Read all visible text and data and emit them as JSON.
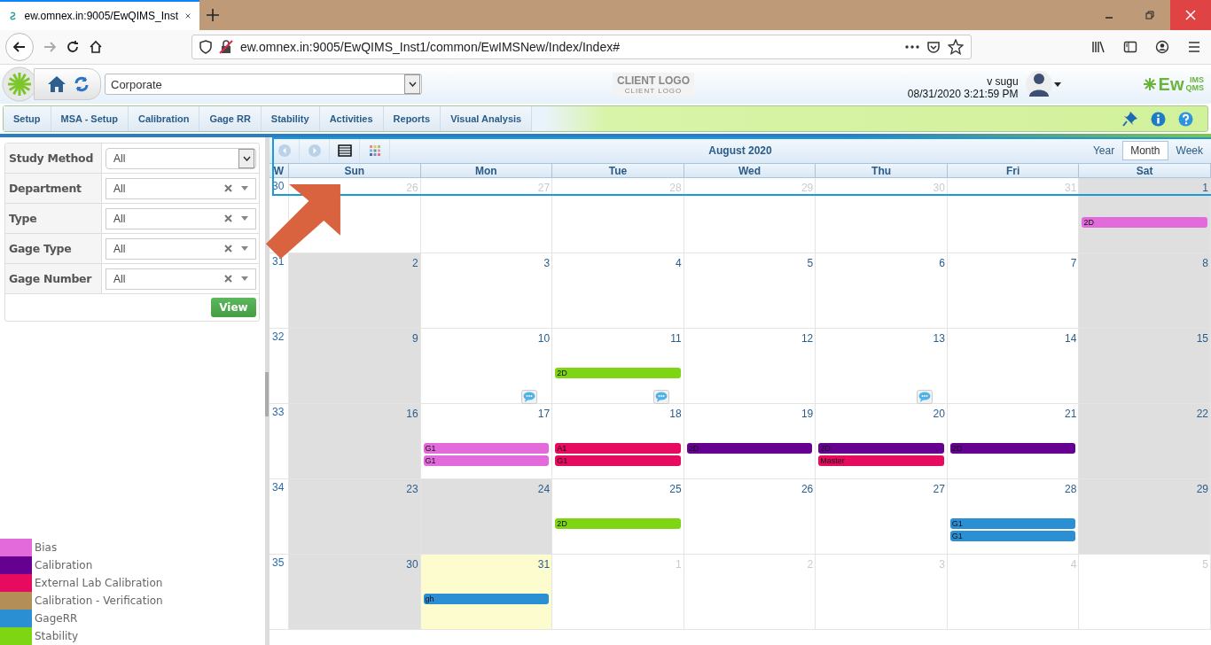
{
  "browser": {
    "tab_title": "ew.omnex.in:9005/EwQIMS_Inst",
    "url": "ew.omnex.in:9005/EwQIMS_Inst1/common/EwIMSNew/Index/Index#"
  },
  "header": {
    "site": "Corporate",
    "client_logo": "CLIENT LOGO",
    "client_logo_sub": "CLIENT LOGO",
    "user": "v sugu",
    "datetime": "08/31/2020 3:21:59 PM",
    "brand": "Ew",
    "brand_sup": "IMS",
    "brand_sub": "QMS"
  },
  "menu": [
    "Setup",
    "MSA - Setup",
    "Calibration",
    "Gage RR",
    "Stability",
    "Activities",
    "Reports",
    "Visual Analysis"
  ],
  "filters": [
    {
      "label": "Study Method",
      "value": "All",
      "kind": "select"
    },
    {
      "label": "Department",
      "value": "All",
      "kind": "combo"
    },
    {
      "label": "Type",
      "value": "All",
      "kind": "combo"
    },
    {
      "label": "Gage Type",
      "value": "All",
      "kind": "combo"
    },
    {
      "label": "Gage Number",
      "value": "All",
      "kind": "combo"
    }
  ],
  "view_button": "View",
  "legend": [
    {
      "label": "Bias",
      "color": "#e36adb"
    },
    {
      "label": "Calibration",
      "color": "#650090"
    },
    {
      "label": "External Lab Calibration",
      "color": "#e60b5f"
    },
    {
      "label": "Calibration - Verification",
      "color": "#b48e57"
    },
    {
      "label": "GageRR",
      "color": "#2b8fd4"
    },
    {
      "label": "Stability",
      "color": "#7ed514"
    }
  ],
  "calendar": {
    "title": "August 2020",
    "views": [
      {
        "label": "Year",
        "selected": false
      },
      {
        "label": "Month",
        "selected": true
      },
      {
        "label": "Week",
        "selected": false
      }
    ],
    "week_header": "W",
    "days": [
      "Sun",
      "Mon",
      "Tue",
      "Wed",
      "Thu",
      "Fri",
      "Sat"
    ],
    "weeks": [
      {
        "number": "30",
        "days": [
          {
            "date": "26",
            "kind": "outside",
            "comment": false
          },
          {
            "date": "27",
            "kind": "outside",
            "comment": false
          },
          {
            "date": "28",
            "kind": "outside",
            "comment": false
          },
          {
            "date": "29",
            "kind": "outside",
            "comment": false
          },
          {
            "date": "30",
            "kind": "outside",
            "comment": false
          },
          {
            "date": "31",
            "kind": "outside",
            "comment": false
          },
          {
            "date": "1",
            "kind": "off",
            "comment": false,
            "events": [
              {
                "text": "2D",
                "color": "#e36adb"
              }
            ]
          }
        ]
      },
      {
        "number": "31",
        "days": [
          {
            "date": "2",
            "kind": "off",
            "comment": false
          },
          {
            "date": "3",
            "kind": "workday",
            "comment": false
          },
          {
            "date": "4",
            "kind": "workday",
            "comment": false
          },
          {
            "date": "5",
            "kind": "workday",
            "comment": false
          },
          {
            "date": "6",
            "kind": "workday",
            "comment": false
          },
          {
            "date": "7",
            "kind": "workday",
            "comment": false
          },
          {
            "date": "8",
            "kind": "off",
            "comment": false
          }
        ]
      },
      {
        "number": "32",
        "days": [
          {
            "date": "9",
            "kind": "off",
            "comment": false
          },
          {
            "date": "10",
            "kind": "workday",
            "comment": true
          },
          {
            "date": "11",
            "kind": "workday",
            "comment": true,
            "events": [
              {
                "text": "2D",
                "color": "#7ed514"
              }
            ]
          },
          {
            "date": "12",
            "kind": "workday",
            "comment": false
          },
          {
            "date": "13",
            "kind": "workday",
            "comment": true
          },
          {
            "date": "14",
            "kind": "workday",
            "comment": false
          },
          {
            "date": "15",
            "kind": "off",
            "comment": false
          }
        ]
      },
      {
        "number": "33",
        "days": [
          {
            "date": "16",
            "kind": "off",
            "comment": false
          },
          {
            "date": "17",
            "kind": "workday",
            "comment": false,
            "events": [
              {
                "text": "G1",
                "color": "#e36adb"
              },
              {
                "text": "G1",
                "color": "#e36adb"
              }
            ]
          },
          {
            "date": "18",
            "kind": "workday",
            "comment": false,
            "events": [
              {
                "text": "A1",
                "color": "#e60b5f"
              },
              {
                "text": "G1",
                "color": "#e60b5f"
              }
            ]
          },
          {
            "date": "19",
            "kind": "workday",
            "comment": false,
            "events": [
              {
                "text": "2D",
                "color": "#650090"
              }
            ]
          },
          {
            "date": "20",
            "kind": "workday",
            "comment": false,
            "events": [
              {
                "text": "2D",
                "color": "#650090"
              },
              {
                "text": "Master",
                "color": "#e60b5f"
              }
            ]
          },
          {
            "date": "21",
            "kind": "workday",
            "comment": false,
            "events": [
              {
                "text": "2D",
                "color": "#650090"
              }
            ]
          },
          {
            "date": "22",
            "kind": "off",
            "comment": false
          }
        ]
      },
      {
        "number": "34",
        "days": [
          {
            "date": "23",
            "kind": "off",
            "comment": false
          },
          {
            "date": "24",
            "kind": "off",
            "comment": false
          },
          {
            "date": "25",
            "kind": "workday",
            "comment": false,
            "events": [
              {
                "text": "2D",
                "color": "#7ed514"
              }
            ]
          },
          {
            "date": "26",
            "kind": "workday",
            "comment": false
          },
          {
            "date": "27",
            "kind": "workday",
            "comment": false
          },
          {
            "date": "28",
            "kind": "workday",
            "comment": false,
            "events": [
              {
                "text": "G1",
                "color": "#2b8fd4"
              },
              {
                "text": "G1",
                "color": "#2b8fd4"
              }
            ]
          },
          {
            "date": "29",
            "kind": "off",
            "comment": false
          }
        ]
      },
      {
        "number": "35",
        "days": [
          {
            "date": "30",
            "kind": "off",
            "comment": false
          },
          {
            "date": "31",
            "kind": "today",
            "comment": false,
            "events": [
              {
                "text": "gh",
                "color": "#2b8fd4"
              }
            ]
          },
          {
            "date": "1",
            "kind": "outside",
            "comment": false
          },
          {
            "date": "2",
            "kind": "outside",
            "comment": false
          },
          {
            "date": "3",
            "kind": "outside",
            "comment": false
          },
          {
            "date": "4",
            "kind": "outside",
            "comment": false
          },
          {
            "date": "5",
            "kind": "outside",
            "comment": false
          }
        ]
      }
    ]
  }
}
